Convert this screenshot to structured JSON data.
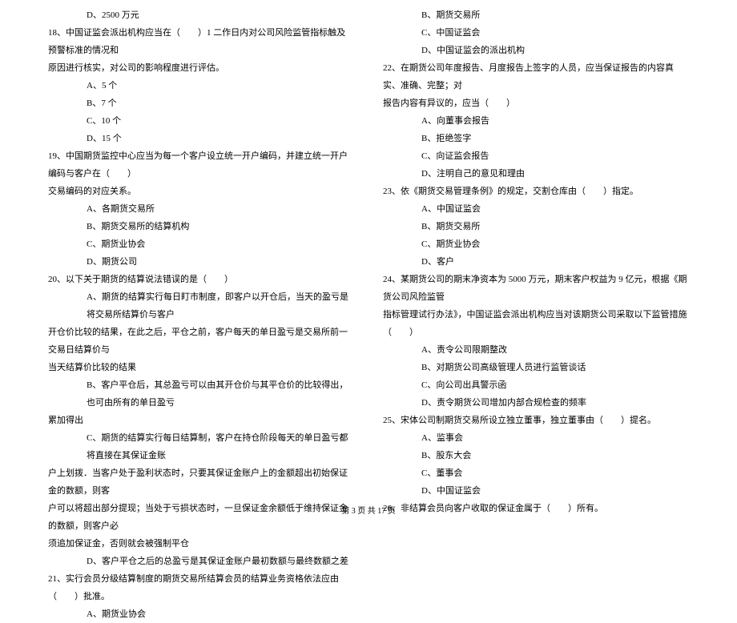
{
  "leftColumn": {
    "opt17d": "D、2500 万元",
    "q18_line1": "18、中国证监会派出机构应当在（　　）1 二作日内对公司风险监管指标触及预警标准的情况和",
    "q18_line2": "原因进行核实，对公司的影响程度进行评估。",
    "q18_a": "A、5 个",
    "q18_b": "B、7 个",
    "q18_c": "C、10 个",
    "q18_d": "D、15 个",
    "q19_line1": "19、中国期货监控中心应当为每一个客户设立统一开户编码，并建立统一开户编码与客户在（　　）",
    "q19_line2": "交易编码的对应关系。",
    "q19_a": "A、各期货交易所",
    "q19_b": "B、期货交易所的结算机构",
    "q19_c": "C、期货业协会",
    "q19_d": "D、期货公司",
    "q20_line1": "20、以下关于期货的结算说法错误的是（　　）",
    "q20_a_line1": "A、期货的结算实行每日盯市制度，即客户以开仓后，当天的盈亏是将交易所结算价与客户",
    "q20_a_line2": "开仓价比较的结果，在此之后，平仓之前，客户每天的单日盈亏是交易所前一交易日结算价与",
    "q20_a_line3": "当天结算价比较的结果",
    "q20_b_line1": "B、客户平仓后，其总盈亏可以由其开仓价与其平仓价的比较得出，也可由所有的单日盈亏",
    "q20_b_line2": "累加得出",
    "q20_c_line1": "C、期货的结算实行每日结算制，客户在持仓阶段每天的单日盈亏都将直接在其保证金账",
    "q20_c_line2": "户上划拨．当客户处于盈利状态时，只要其保证金账户上的金额超出初始保证金的数额，则客",
    "q20_c_line3": "户可以将超出部分提现；当处于亏损状态时，一旦保证金余额低于维持保证金的数额，则客户必",
    "q20_c_line4": "须追加保证金，否则就会被强制平仓",
    "q20_d": "D、客户平仓之后的总盈亏是其保证金账户最初数额与最终数额之差",
    "q21_line1": "21、实行会员分级结算制度的期货交易所结算会员的结算业务资格依法应由（　　）批准。",
    "q21_a": "A、期货业协会"
  },
  "rightColumn": {
    "q21_b": "B、期货交易所",
    "q21_c": "C、中国证监会",
    "q21_d": "D、中国证监会的派出机构",
    "q22_line1": "22、在期货公司年度报告、月度报告上签字的人员，应当保证报告的内容真实、准确、完整；对",
    "q22_line2": "报告内容有异议的，应当（　　）",
    "q22_a": "A、向董事会报告",
    "q22_b": "B、拒绝签字",
    "q22_c": "C、向证监会报告",
    "q22_d": "D、注明自己的意见和理由",
    "q23_line1": "23、依《期货交易管理条例》的规定，交割仓库由（　　）指定。",
    "q23_a": "A、中国证监会",
    "q23_b": "B、期货交易所",
    "q23_c": "C、期货业协会",
    "q23_d": "D、客户",
    "q24_line1": "24、某期货公司的期末净资本为 5000 万元，期末客户权益为 9 亿元，根据《期货公司风险监管",
    "q24_line2": "指标管理试行办法》，中国证监会派出机构应当对该期货公司采取以下监管措施（　　）",
    "q24_a": "A、责令公司限期整改",
    "q24_b": "B、对期货公司高级管理人员进行监管谈话",
    "q24_c": "C、向公司出具警示函",
    "q24_d": "D、责令期货公司增加内部合规检查的频率",
    "q25_line1": "25、宋体公司制期货交易所设立独立董事，独立董事由（　　）提名。",
    "q25_a": "A、监事会",
    "q25_b": "B、股东大会",
    "q25_c": "C、董事会",
    "q25_d": "D、中国证监会",
    "q26_line1": "26、非结算会员向客户收取的保证金属于（　　）所有。"
  },
  "footer": "第 3 页 共 17 页"
}
